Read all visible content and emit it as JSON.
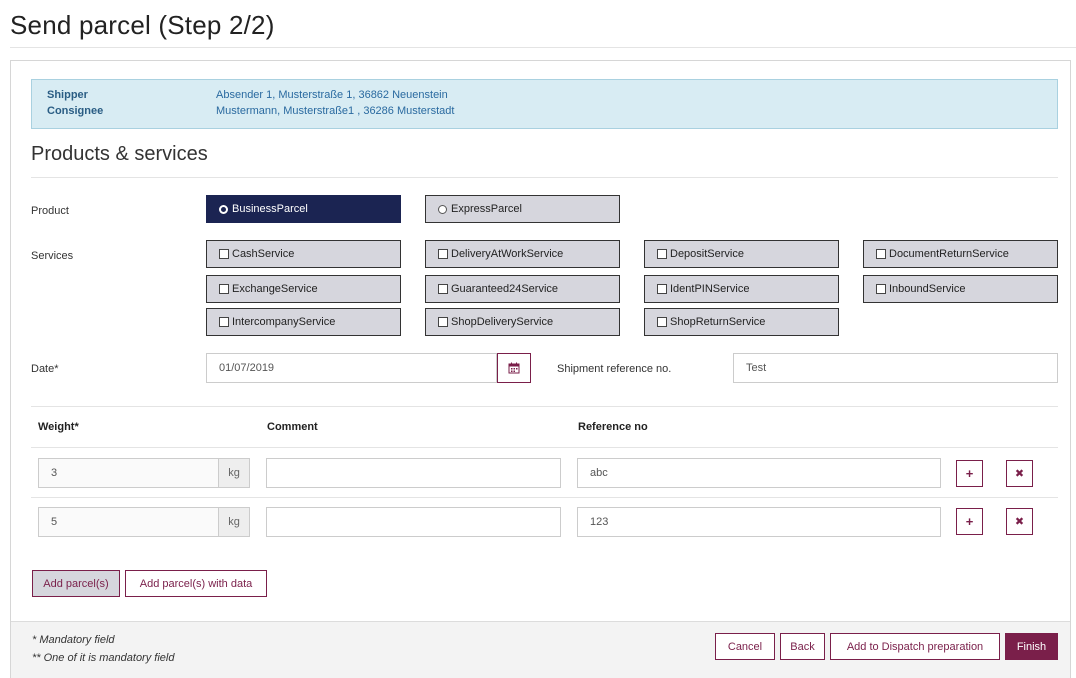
{
  "page": {
    "title": "Send parcel (Step 2/2)"
  },
  "info": {
    "shipper_label": "Shipper",
    "shipper_value": "Absender 1, Musterstraße 1, 36862 Neuenstein",
    "consignee_label": "Consignee",
    "consignee_value": "Mustermann, Musterstraße1 , 36286 Musterstadt"
  },
  "products": {
    "section_title": "Products & services",
    "product_label": "Product",
    "product_options": [
      "BusinessParcel",
      "ExpressParcel"
    ],
    "selected_product": "BusinessParcel",
    "services_label": "Services",
    "services": [
      "CashService",
      "DeliveryAtWorkService",
      "DepositService",
      "DocumentReturnService",
      "ExchangeService",
      "Guaranteed24Service",
      "IdentPINService",
      "InboundService",
      "IntercompanyService",
      "ShopDeliveryService",
      "ShopReturnService"
    ]
  },
  "date": {
    "label": "Date*",
    "value": "01/07/2019",
    "icon": "calendar-icon"
  },
  "shipment_ref": {
    "label": "Shipment reference no.",
    "value": "Test"
  },
  "parcels": {
    "headers": {
      "weight": "Weight*",
      "comment": "Comment",
      "reference": "Reference no"
    },
    "unit": "kg",
    "rows": [
      {
        "weight": "3",
        "comment": "",
        "reference": "abc"
      },
      {
        "weight": "5",
        "comment": "",
        "reference": "123"
      }
    ],
    "add_icon": "+",
    "remove_icon": "✖"
  },
  "actions": {
    "add_parcels": "Add parcel(s)",
    "add_parcels_with_data": "Add parcel(s) with data"
  },
  "footer": {
    "note1": "* Mandatory field",
    "note2": "** One of it is mandatory field",
    "cancel": "Cancel",
    "back": "Back",
    "dispatch": "Add to Dispatch preparation",
    "finish": "Finish"
  },
  "colors": {
    "brand": "#7a1f4a",
    "selected": "#1b2452",
    "info_bg": "#d8ecf3"
  }
}
